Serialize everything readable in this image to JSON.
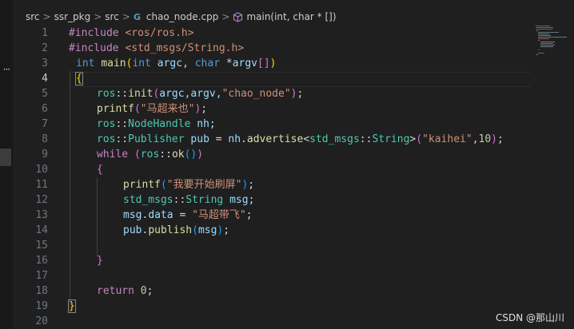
{
  "breadcrumb": {
    "items": [
      "src",
      "ssr_pkg",
      "src",
      "chao_node.cpp",
      "main(int, char * [])"
    ],
    "separator": ">"
  },
  "editor": {
    "active_line": 4,
    "lines": [
      {
        "n": "1"
      },
      {
        "n": "2"
      },
      {
        "n": "3"
      },
      {
        "n": "4"
      },
      {
        "n": "5"
      },
      {
        "n": "6"
      },
      {
        "n": "7"
      },
      {
        "n": "8"
      },
      {
        "n": "9"
      },
      {
        "n": "10"
      },
      {
        "n": "11"
      },
      {
        "n": "12"
      },
      {
        "n": "13"
      },
      {
        "n": "14"
      },
      {
        "n": "15"
      },
      {
        "n": "16"
      },
      {
        "n": "17"
      },
      {
        "n": "18"
      },
      {
        "n": "19"
      },
      {
        "n": "20"
      }
    ],
    "tokens": {
      "l1_directive": "#include",
      "l1_header": "<ros/ros.h>",
      "l2_directive": "#include",
      "l2_header": "<std_msgs/String.h>",
      "l3_int": "int",
      "l3_main": "main",
      "l3_open": "(",
      "l3_int2": "int",
      "l3_argc": "argc",
      "l3_comma": ",",
      "l3_char": "char",
      "l3_star": "*",
      "l3_argv": "argv",
      "l3_brackets": "[]",
      "l3_close": ")",
      "l4_brace": "{",
      "l5_ns": "ros",
      "l5_sep": "::",
      "l5_fn": "init",
      "l5_open": "(",
      "l5_args": "argc,argv,",
      "l5_str": "\"chao_node\"",
      "l5_close": ")",
      "l5_semi": ";",
      "l6_fn": "printf",
      "l6_open": "(",
      "l6_str": "\"马超来也\"",
      "l6_close": ")",
      "l6_semi": ";",
      "l7_ns": "ros",
      "l7_sep": "::",
      "l7_type": "NodeHandle",
      "l7_var": "nh",
      "l7_semi": ";",
      "l8_ns": "ros",
      "l8_sep": "::",
      "l8_type": "Publisher",
      "l8_var": "pub",
      "l8_eq": "=",
      "l8_nh": "nh",
      "l8_dot": ".",
      "l8_fn": "advertise",
      "l8_lt": "<",
      "l8_ns2": "std_msgs",
      "l8_sep2": "::",
      "l8_type2": "String",
      "l8_gt": ">",
      "l8_open": "(",
      "l8_str": "\"kaihei\"",
      "l8_comma": ",",
      "l8_num": "10",
      "l8_close": ")",
      "l8_semi": ";",
      "l9_while": "while",
      "l9_open": "(",
      "l9_ns": "ros",
      "l9_sep": "::",
      "l9_fn": "ok",
      "l9_call": "()",
      "l9_close": ")",
      "l10_brace": "{",
      "l11_fn": "printf",
      "l11_open": "(",
      "l11_str": "\"我要开始刷屏\"",
      "l11_close": ")",
      "l11_semi": ";",
      "l12_ns": "std_msgs",
      "l12_sep": "::",
      "l12_type": "String",
      "l12_var": "msg",
      "l12_semi": ";",
      "l13_var": "msg",
      "l13_dot": ".",
      "l13_field": "data",
      "l13_eq": "=",
      "l13_str": "\"马超带飞\"",
      "l13_semi": ";",
      "l14_var": "pub",
      "l14_dot": ".",
      "l14_fn": "publish",
      "l14_open": "(",
      "l14_arg": "msg",
      "l14_close": ")",
      "l14_semi": ";",
      "l16_brace": "}",
      "l18_return": "return",
      "l18_num": "0",
      "l18_semi": ";",
      "l19_brace": "}"
    }
  },
  "watermark": "CSDN @那山川",
  "colors": {
    "background": "#1f1f1f",
    "keyword": "#569cd6",
    "control": "#c586c0",
    "type": "#4ec9b0",
    "function": "#dcdcaa",
    "variable": "#9cdcfe",
    "string": "#ce9178",
    "number": "#b5cea8",
    "bracket_level1": "#ffd700",
    "bracket_level2": "#da70d6",
    "bracket_level3": "#179fff"
  },
  "icons": {
    "file_type": "cpp-file-icon",
    "symbol": "method-cube-icon",
    "activity": "more-dots-icon"
  }
}
